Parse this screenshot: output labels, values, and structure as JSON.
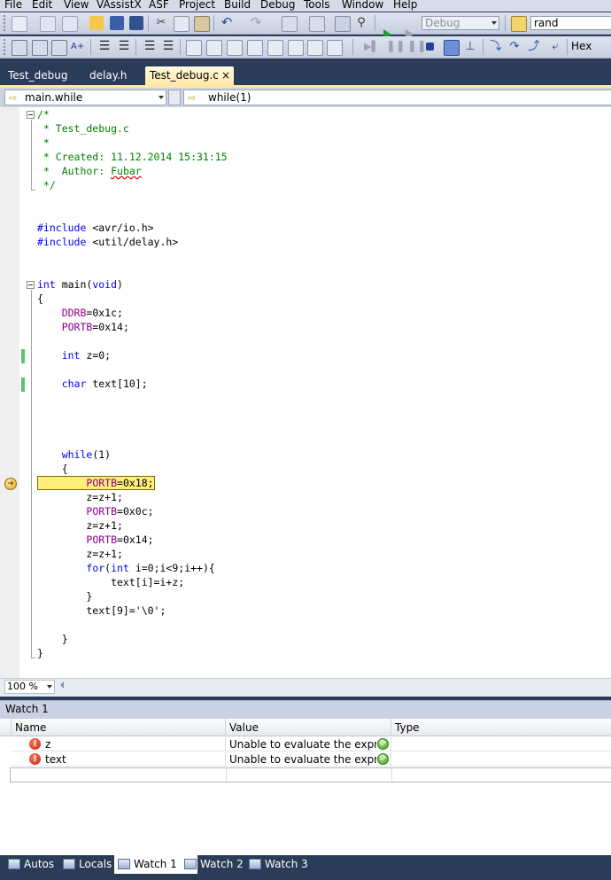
{
  "menu": [
    "File",
    "Edit",
    "View",
    "VAssistX",
    "ASF",
    "Project",
    "Build",
    "Debug",
    "Tools",
    "Window",
    "Help"
  ],
  "toolbar": {
    "config_combo": "Debug",
    "find_combo": "rand",
    "hex_label": "Hex"
  },
  "doc_tabs": [
    "Test_debug",
    "delay.h",
    "Test_debug.c"
  ],
  "active_tab_close": "×",
  "navbar": {
    "scope": "main.while",
    "member": "while(1)"
  },
  "code": [
    {
      "t": "/*",
      "c": "#008000"
    },
    {
      "t": " * Test_debug.c",
      "c": "#008000"
    },
    {
      "t": " *",
      "c": "#008000"
    },
    {
      "t": " * Created: 11.12.2014 15:31:15",
      "c": "#008000"
    },
    {
      "t": " *  Author: Fubar",
      "c": "#008000"
    },
    {
      "t": " */",
      "c": "#008000"
    },
    {
      "t": "",
      "c": "#000"
    },
    {
      "t": "",
      "c": "#000"
    },
    {
      "t": "#include <avr/io.h>",
      "c": "#000"
    },
    {
      "t": "#include <util/delay.h>",
      "c": "#000"
    },
    {
      "t": "",
      "c": "#000"
    },
    {
      "t": "",
      "c": "#000"
    },
    {
      "t": "int main(void)",
      "c": "#000"
    },
    {
      "t": "{",
      "c": "#000"
    },
    {
      "t": "    DDRB=0x1c;",
      "c": "#000"
    },
    {
      "t": "    PORTB=0x14;",
      "c": "#000"
    },
    {
      "t": "",
      "c": "#000"
    },
    {
      "t": "    int z=0;",
      "c": "#000"
    },
    {
      "t": "",
      "c": "#000"
    },
    {
      "t": "    char text[10];",
      "c": "#000"
    },
    {
      "t": "",
      "c": "#000"
    },
    {
      "t": "",
      "c": "#000"
    },
    {
      "t": "",
      "c": "#000"
    },
    {
      "t": "",
      "c": "#000"
    },
    {
      "t": "    while(1)",
      "c": "#000"
    },
    {
      "t": "    {",
      "c": "#000"
    },
    {
      "t": "        PORTB=0x18;",
      "c": "#000"
    },
    {
      "t": "        z=z+1;",
      "c": "#000"
    },
    {
      "t": "        PORTB=0x0c;",
      "c": "#000"
    },
    {
      "t": "        z=z+1;",
      "c": "#000"
    },
    {
      "t": "        PORTB=0x14;",
      "c": "#000"
    },
    {
      "t": "        z=z+1;",
      "c": "#000"
    },
    {
      "t": "        for(int i=0;i<9;i++){",
      "c": "#000"
    },
    {
      "t": "            text[i]=i+z;",
      "c": "#000"
    },
    {
      "t": "        }",
      "c": "#000"
    },
    {
      "t": "        text[9]='\\0';",
      "c": "#000"
    },
    {
      "t": "",
      "c": "#000"
    },
    {
      "t": "    }",
      "c": "#000"
    },
    {
      "t": "}",
      "c": "#000"
    }
  ],
  "zoom": "100 %",
  "watch": {
    "title": "Watch 1",
    "columns": [
      "Name",
      "Value",
      "Type"
    ],
    "rows": [
      {
        "name": "z",
        "value": "Unable to evaluate the expressio",
        "type": ""
      },
      {
        "name": "text",
        "value": "Unable to evaluate the expressio",
        "type": ""
      }
    ]
  },
  "bottom_tabs": [
    "Autos",
    "Locals",
    "Watch 1",
    "Watch 2",
    "Watch 3"
  ],
  "colors": {
    "keyword": "#0000ff",
    "comment": "#008000",
    "macro": "#8b008b",
    "current_stmt": "#ffee7a",
    "chrome": "#2b3c59"
  }
}
